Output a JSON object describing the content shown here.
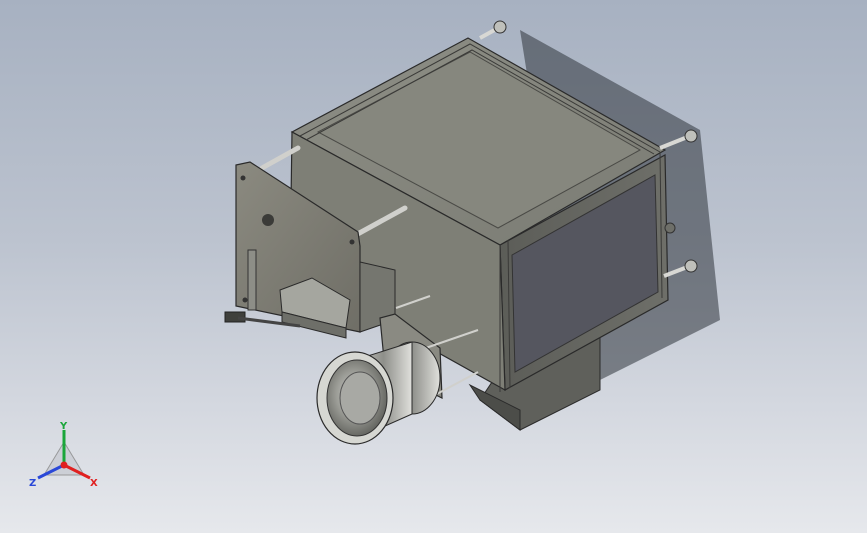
{
  "viewport": {
    "model_name": "",
    "background": {
      "top": "#a7b1c1",
      "bottom": "#e6e8ec"
    }
  },
  "triad": {
    "x_label": "X",
    "y_label": "Y",
    "z_label": "Z",
    "x_color": "#e02020",
    "y_color": "#1aa63a",
    "z_color": "#2a48d8"
  },
  "model": {
    "parts": [
      "housing",
      "rear-panel",
      "tie-rods",
      "mounting-plate",
      "lens-barrel",
      "slide-stage",
      "bottom-duct"
    ],
    "body_color": "#8a8b82",
    "edge_color": "#2a2a2a"
  }
}
